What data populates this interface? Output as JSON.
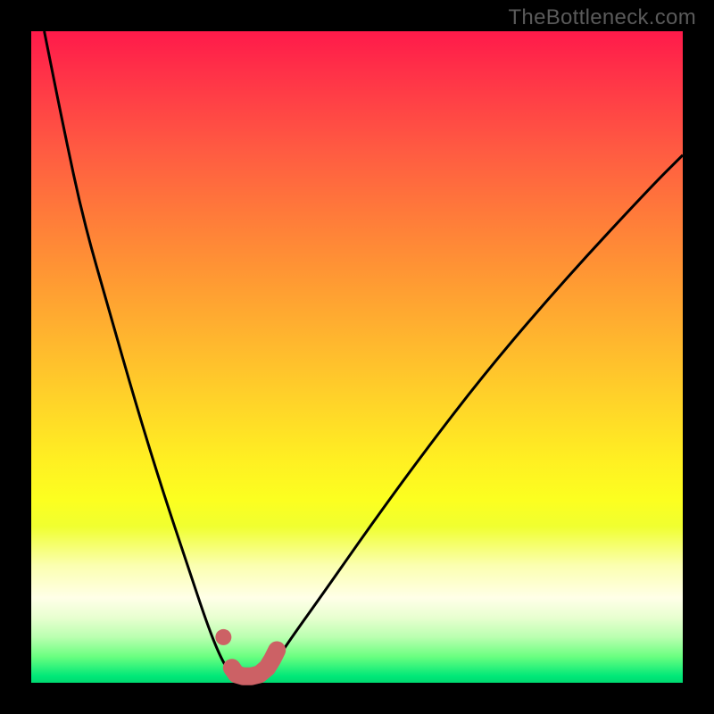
{
  "watermark": "TheBottleneck.com",
  "colors": {
    "background": "#000000",
    "gradient_top": "#ff1a4a",
    "gradient_bottom": "#00d870",
    "curve": "#000000",
    "marker": "#cc6165"
  },
  "chart_data": {
    "type": "line",
    "title": "",
    "xlabel": "",
    "ylabel": "",
    "xlim": [
      0,
      100
    ],
    "ylim": [
      0,
      100
    ],
    "series": [
      {
        "name": "bottleneck-curve",
        "x": [
          2,
          5,
          8,
          12,
          16,
          20,
          24,
          27,
          29,
          30.5,
          32,
          34,
          36,
          38,
          40,
          45,
          52,
          60,
          70,
          82,
          95,
          100
        ],
        "y": [
          100,
          85,
          71,
          57,
          43,
          30,
          18,
          9,
          4,
          1.5,
          1,
          1.2,
          2,
          4,
          7,
          14,
          24,
          35,
          48,
          62,
          76,
          81
        ]
      }
    ],
    "markers": [
      {
        "name": "marker-left-dot",
        "x": 29.5,
        "y": 7
      },
      {
        "name": "marker-bottom-segment",
        "points": [
          {
            "x": 30.8,
            "y": 2.3
          },
          {
            "x": 31.5,
            "y": 1.3
          },
          {
            "x": 32.5,
            "y": 1.0
          },
          {
            "x": 33.8,
            "y": 1.0
          },
          {
            "x": 35.0,
            "y": 1.3
          },
          {
            "x": 36.2,
            "y": 2.3
          },
          {
            "x": 37.0,
            "y": 3.6
          },
          {
            "x": 37.7,
            "y": 5.0
          }
        ]
      }
    ]
  }
}
